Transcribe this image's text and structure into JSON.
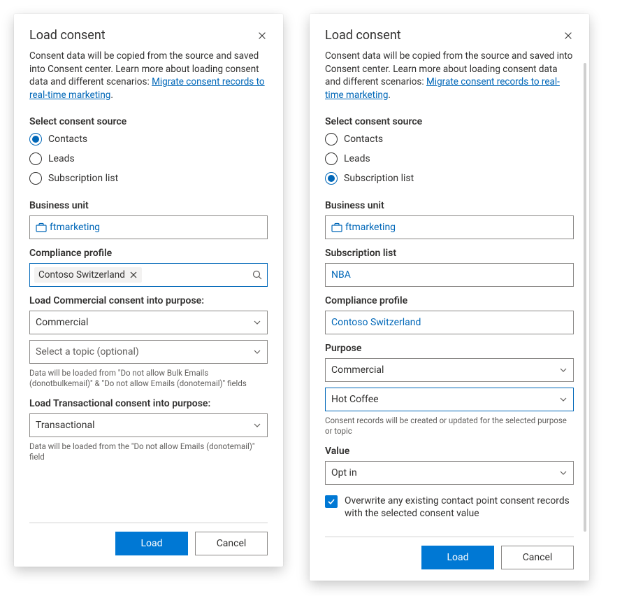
{
  "left": {
    "title": "Load consent",
    "intro_pre": "Consent data will be copied from the source and saved into Consent center. Learn more about loading consent data and different scenarios: ",
    "intro_link": "Migrate consent records to real-time marketing",
    "intro_post": ".",
    "source_heading": "Select consent source",
    "radios": {
      "contacts": "Contacts",
      "leads": "Leads",
      "sublist": "Subscription list"
    },
    "selected_radio": "contacts",
    "bu_label": "Business unit",
    "bu_value": "ftmarketing",
    "profile_label": "Compliance profile",
    "profile_value": "Contoso Switzerland",
    "comm_heading": "Load Commercial consent into purpose:",
    "comm_purpose": "Commercial",
    "comm_topic_placeholder": "Select a topic (optional)",
    "comm_hint": "Data will be loaded from \"Do not allow Bulk Emails (donotbulkemail)\" & \"Do not allow Emails (donotemail)\" fields",
    "trans_heading": "Load Transactional consent into purpose:",
    "trans_purpose": "Transactional",
    "trans_hint": "Data will be loaded from the \"Do not allow Emails (donotemail)\" field",
    "btn_load": "Load",
    "btn_cancel": "Cancel"
  },
  "right": {
    "title": "Load consent",
    "intro_pre": "Consent data will be copied from the source and saved into Consent center. Learn more about loading consent data and different scenarios: ",
    "intro_link": "Migrate consent records to real-time marketing",
    "intro_post": ".",
    "source_heading": "Select consent source",
    "radios": {
      "contacts": "Contacts",
      "leads": "Leads",
      "sublist": "Subscription list"
    },
    "selected_radio": "sublist",
    "bu_label": "Business unit",
    "bu_value": "ftmarketing",
    "sublist_label": "Subscription list",
    "sublist_value": "NBA",
    "profile_label": "Compliance profile",
    "profile_value": "Contoso Switzerland",
    "purpose_label": "Purpose",
    "purpose_value": "Commercial",
    "topic_value": "Hot Coffee",
    "purpose_hint": "Consent records will be created or updated for the selected purpose or topic",
    "value_label": "Value",
    "value_value": "Opt in",
    "overwrite_label": "Overwrite any existing contact point consent records with the selected consent value",
    "btn_load": "Load",
    "btn_cancel": "Cancel"
  }
}
